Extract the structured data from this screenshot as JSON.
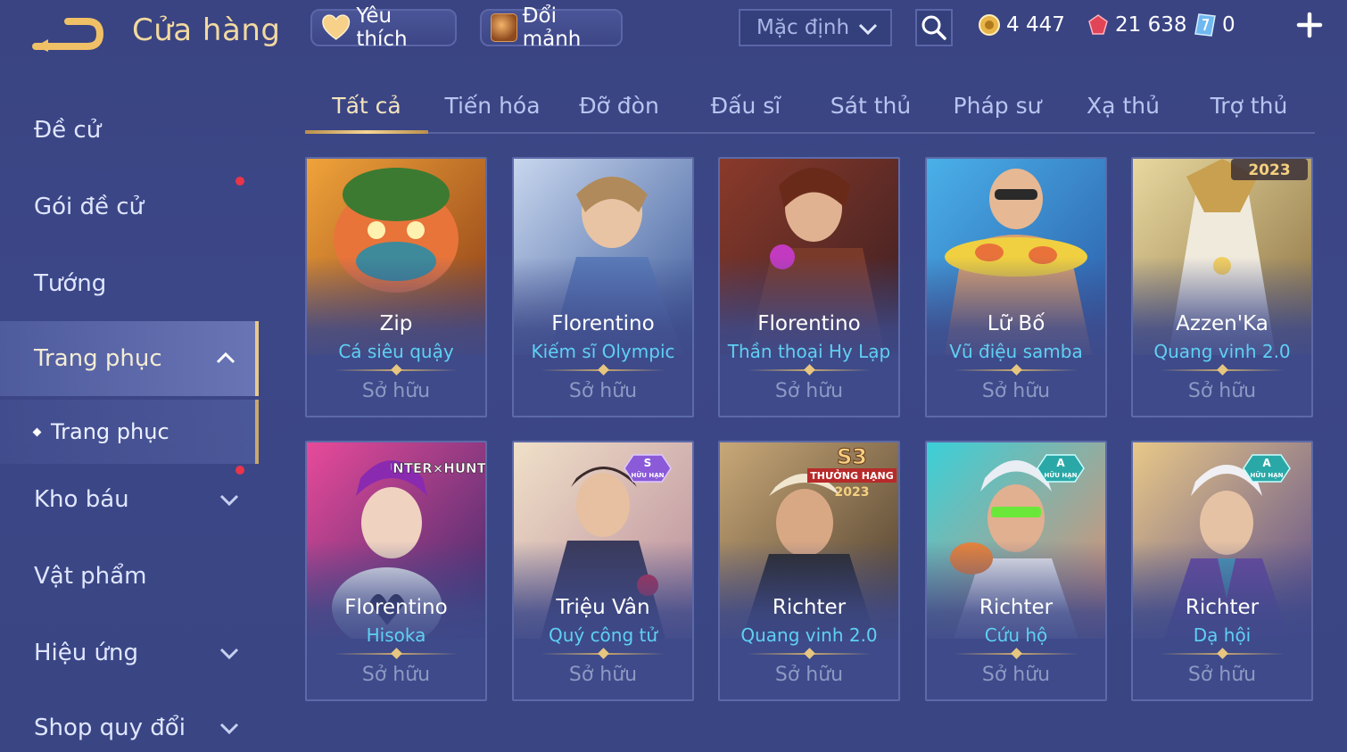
{
  "header": {
    "title": "Cửa hàng",
    "favorites_label": "Yêu thích",
    "shards_label": "Đổi mảnh",
    "sort_selected": "Mặc định",
    "gold": "4 447",
    "gems": "21 638",
    "tickets": "0"
  },
  "sidebar": {
    "items": [
      {
        "label": "Đề cử"
      },
      {
        "label": "Gói đề cử"
      },
      {
        "label": "Tướng"
      },
      {
        "label": "Trang phục"
      },
      {
        "label": "Trang phục"
      },
      {
        "label": "Kho báu"
      },
      {
        "label": "Vật phẩm"
      },
      {
        "label": "Hiệu ứng"
      },
      {
        "label": "Shop quy đổi"
      }
    ]
  },
  "tabs": [
    "Tất cả",
    "Tiến hóa",
    "Đỡ đòn",
    "Đấu sĩ",
    "Sát thủ",
    "Pháp sư",
    "Xạ thủ",
    "Trợ thủ"
  ],
  "cards": [
    {
      "hero": "Zip",
      "skin": "Cá siêu quậy",
      "status": "Sở hữu"
    },
    {
      "hero": "Florentino",
      "skin": "Kiếm sĩ Olympic",
      "status": "Sở hữu"
    },
    {
      "hero": "Florentino",
      "skin": "Thần thoại Hy Lạp",
      "status": "Sở hữu"
    },
    {
      "hero": "Lữ Bố",
      "skin": "Vũ điệu samba",
      "status": "Sở hữu"
    },
    {
      "hero": "Azzen'Ka",
      "skin": "Quang vinh 2.0",
      "status": "Sở hữu",
      "badge": "2023"
    },
    {
      "hero": "Florentino",
      "skin": "Hisoka",
      "status": "Sở hữu",
      "badge": "HUNTER×HUNTER"
    },
    {
      "hero": "Triệu Vân",
      "skin": "Quý công tử",
      "status": "Sở hữu",
      "badge_rank": "S",
      "badge_sub": "HỮU HẠN"
    },
    {
      "hero": "Richter",
      "skin": "Quang vinh 2.0",
      "status": "Sở hữu",
      "badge_title": "S3",
      "badge_sub": "THƯỞNG HẠNG",
      "badge_year": "2023"
    },
    {
      "hero": "Richter",
      "skin": "Cứu hộ",
      "status": "Sở hữu",
      "badge_rank": "A",
      "badge_sub": "HỮU HẠN"
    },
    {
      "hero": "Richter",
      "skin": "Dạ hội",
      "status": "Sở hữu",
      "badge_rank": "A",
      "badge_sub": "HỮU HẠN"
    }
  ],
  "colors": {
    "background": "#3b4685",
    "accent_gold": "#f2d9a0",
    "skin_name": "#5fd0f4",
    "notification": "#e8354a"
  },
  "icons": [
    "back-arrow-icon",
    "heart-icon",
    "shard-chest-icon",
    "chevron-down-icon",
    "search-icon",
    "gold-coin-icon",
    "red-gem-icon",
    "blue-ticket-icon",
    "plus-icon",
    "chevron-up-icon"
  ]
}
